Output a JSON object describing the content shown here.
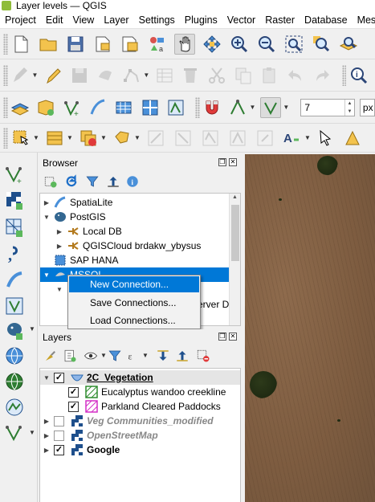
{
  "window": {
    "title": "Layer levels — QGIS"
  },
  "menubar": [
    "Project",
    "Edit",
    "View",
    "Layer",
    "Settings",
    "Plugins",
    "Vector",
    "Raster",
    "Database",
    "Mesh"
  ],
  "snapping": {
    "tolerance": "7",
    "unit": "px"
  },
  "browser": {
    "title": "Browser",
    "items": [
      {
        "label": "SpatiaLite"
      },
      {
        "label": "PostGIS"
      },
      {
        "label": "Local DB"
      },
      {
        "label": "QGISCloud brdakw_ybysus"
      },
      {
        "label": "SAP HANA"
      },
      {
        "label": "MSSQL"
      },
      {
        "label": "erver D"
      }
    ]
  },
  "context_menu": [
    {
      "label": "New Connection..."
    },
    {
      "label": "Save Connections..."
    },
    {
      "label": "Load Connections..."
    }
  ],
  "layers": {
    "title": "Layers",
    "items": [
      {
        "label": "2C_Vegetation",
        "checked": true
      },
      {
        "label": "Eucalyptus wandoo creekline",
        "checked": true,
        "color": "#2e8b2e"
      },
      {
        "label": "Parkland Cleared Paddocks",
        "checked": true,
        "color": "#d42fc6"
      },
      {
        "label": "Veg Communities_modified",
        "checked": false
      },
      {
        "label": "OpenStreetMap",
        "checked": false
      },
      {
        "label": "Google",
        "checked": true
      }
    ]
  },
  "colors": {
    "selection": "#0078d7",
    "map_field": "#7d5c40"
  }
}
